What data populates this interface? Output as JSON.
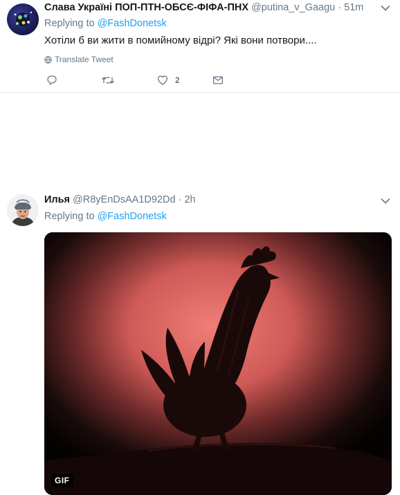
{
  "tweets": [
    {
      "name": "Слава Україні ПОП-ПТН-ОБСЄ-ФІФА-ПНХ",
      "handle": "@putina_v_Gaagu",
      "dot": "·",
      "time": "51m",
      "reply_prefix": "Replying to ",
      "reply_to": "@FashDonetsk",
      "text": "Хотіли б ви жити в помийному відрі? Які вони потвори....",
      "translate_label": "Translate Tweet",
      "likes": "2"
    },
    {
      "name": "Илья",
      "handle": "@R8yEnDsAA1D92Dd",
      "dot": "·",
      "time": "2h",
      "reply_prefix": "Replying to ",
      "reply_to": "@FashDonetsk",
      "media_badge": "GIF"
    }
  ],
  "colors": {
    "link": "#1da1f2",
    "muted": "#657786",
    "text": "#14171a",
    "divider": "#e6ecf0"
  },
  "icons": [
    "reply-icon",
    "retweet-icon",
    "like-icon",
    "message-icon",
    "globe-icon",
    "chevron-down-icon"
  ]
}
